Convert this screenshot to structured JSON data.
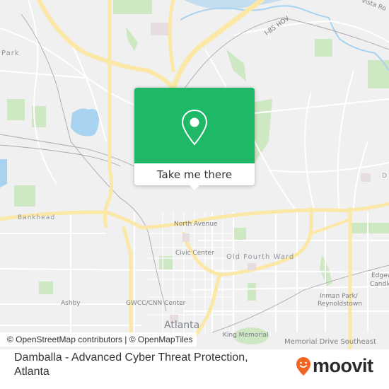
{
  "map": {
    "labels": {
      "park": "Park",
      "i85": "I-85 HOV",
      "vista": "Vista Ro",
      "bankhead": "Bankhead",
      "north_avenue": "North Avenue",
      "civic_center": "Civic Center",
      "old_fourth_ward": "Old Fourth Ward",
      "ashby": "Ashby",
      "gwcc": "GWCC/CNN Center",
      "atlanta": "Atlanta",
      "king_memorial": "King Memorial",
      "inman_park_1": "Inman Park/",
      "inman_park_2": "Reynoldstown",
      "edgewood_1": "Edgew",
      "edgewood_2": "Candle",
      "memorial_drive": "Memorial Drive Southeast",
      "d_label": "D"
    },
    "attribution": "© OpenStreetMap contributors | © OpenMapTiles"
  },
  "popup": {
    "icon": "location-pin-icon",
    "button_label": "Take me there",
    "color": "#1eb866"
  },
  "footer": {
    "place_name": "Damballa - Advanced Cyber Threat Protection, Atlanta",
    "brand": "moovit",
    "brand_color": "#f26522"
  }
}
